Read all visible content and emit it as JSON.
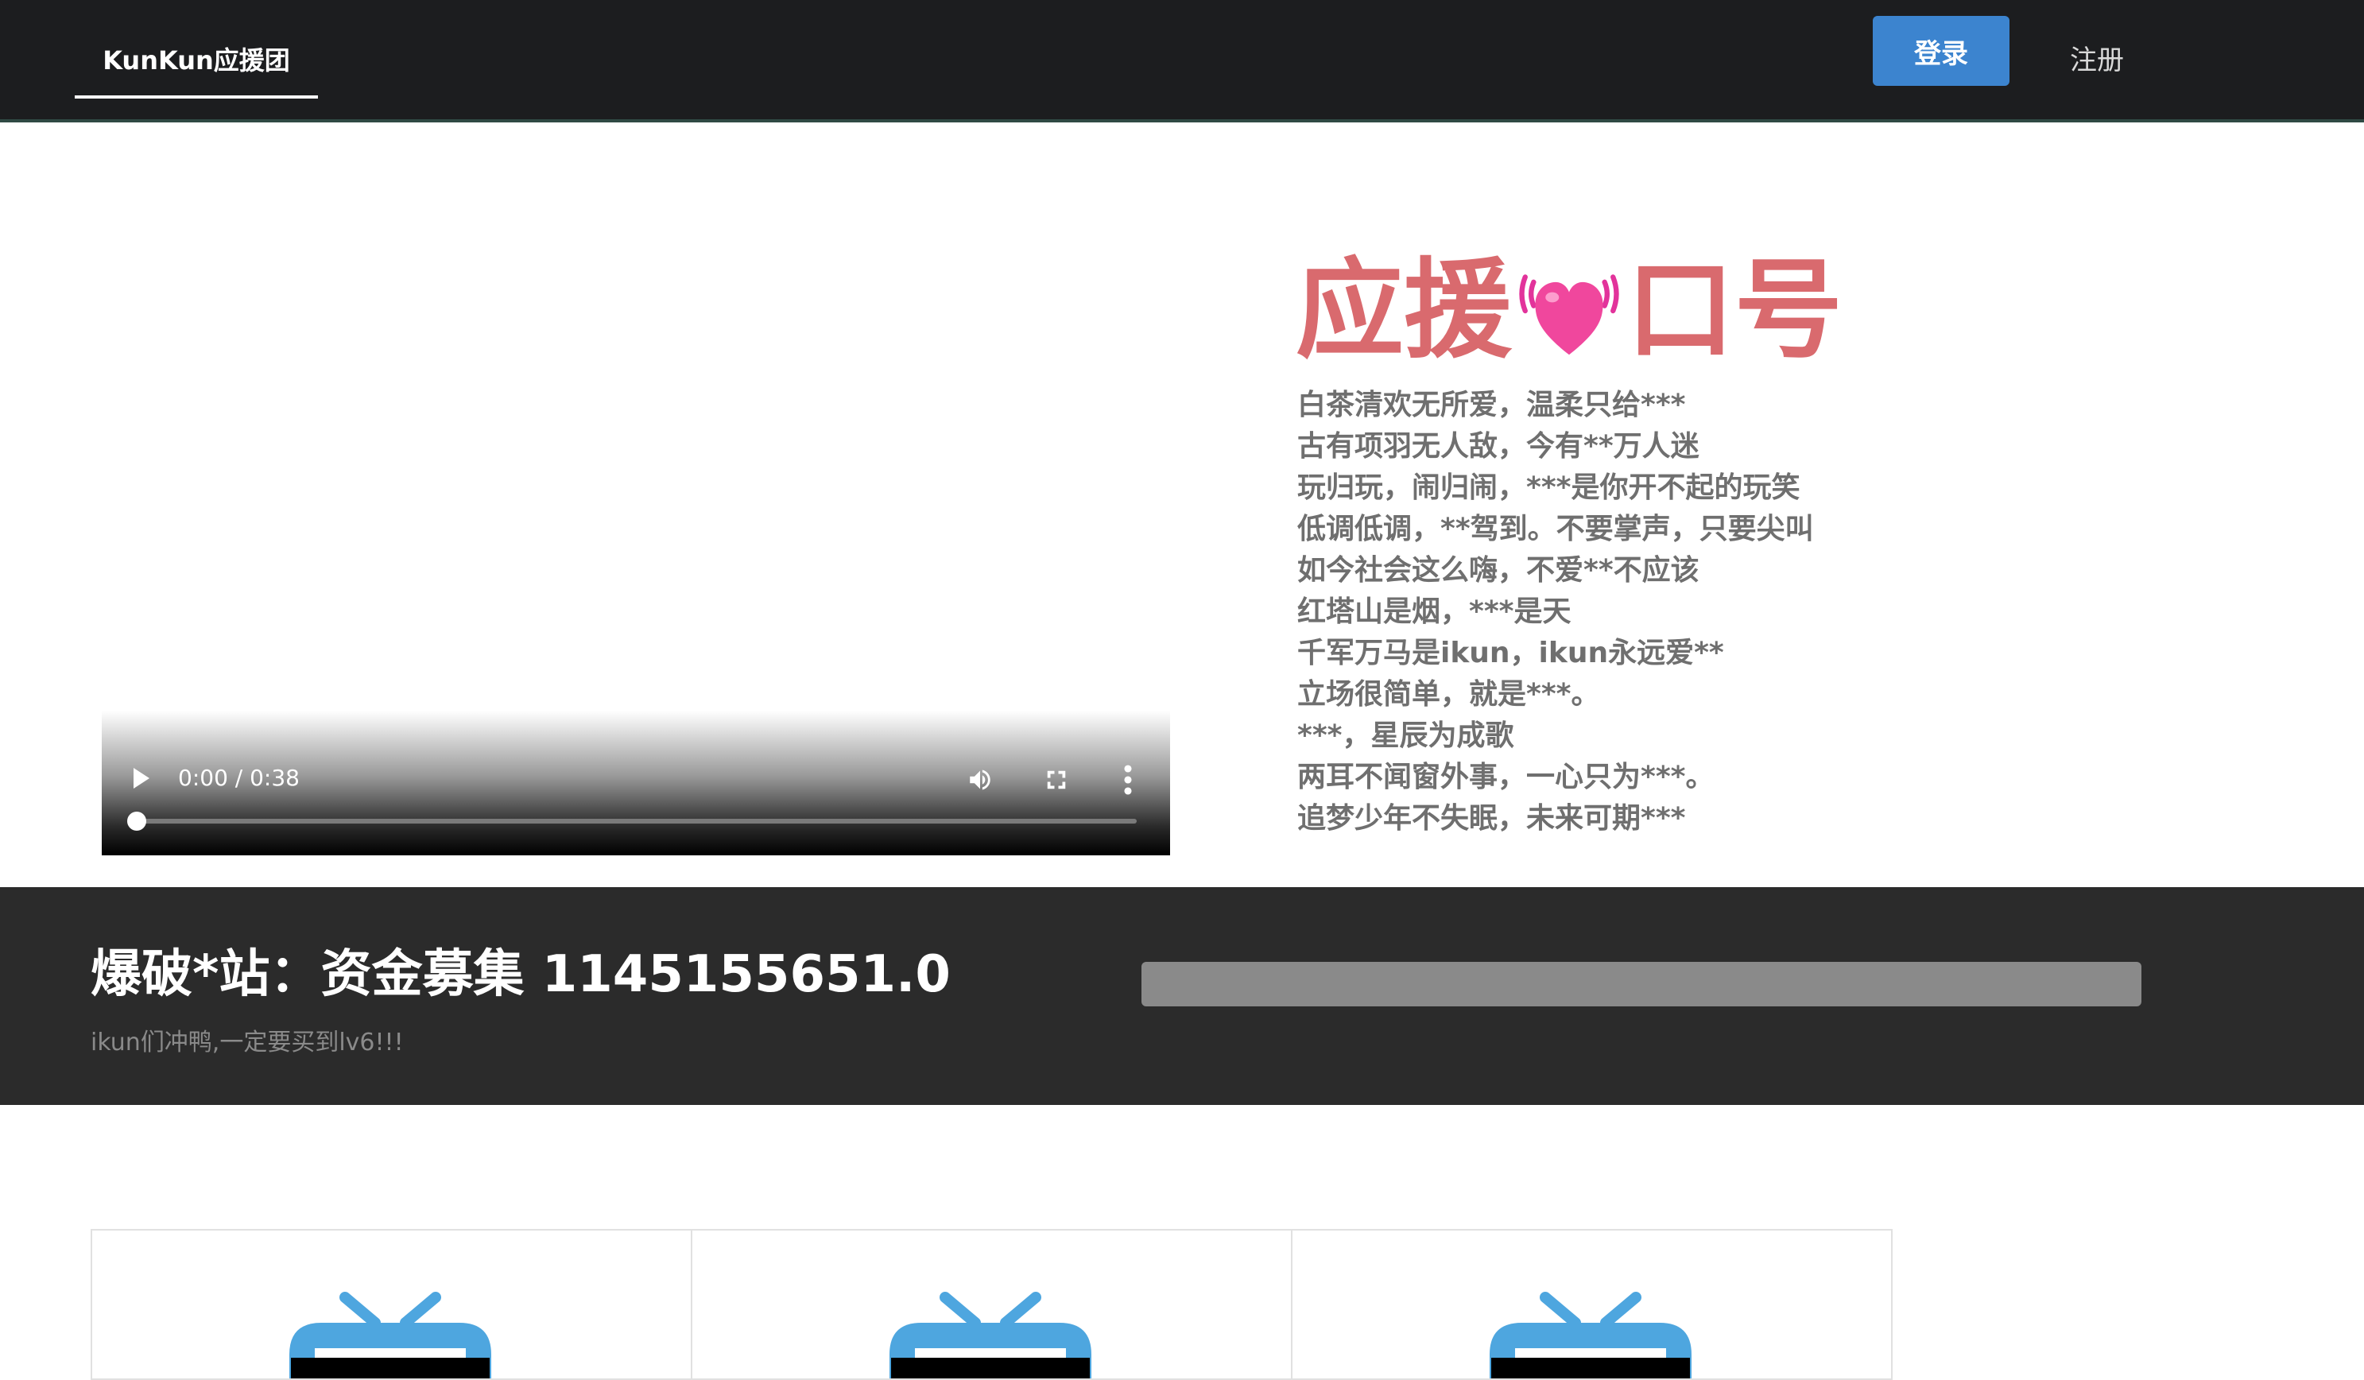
{
  "nav": {
    "brand": "KunKun应援团",
    "login_label": "登录",
    "register_label": "注册"
  },
  "video": {
    "time": "0:00 / 0:38"
  },
  "slogan": {
    "title_left": "应援",
    "title_right": "口号",
    "lines": [
      "白茶清欢无所爱，温柔只给***",
      "古有项羽无人敌，今有**万人迷",
      "玩归玩，闹归闹，***是你开不起的玩笑",
      "低调低调，**驾到。不要掌声，只要尖叫",
      "如今社会这么嗨，不爱**不应该",
      "红塔山是烟，***是天",
      "千军万马是ikun，ikun永远爱**",
      "立场很简单，就是***。",
      "***，星辰为成歌",
      "两耳不闻窗外事，一心只为***。",
      "追梦少年不失眠，未来可期***"
    ]
  },
  "funding": {
    "label": "爆破*站：资金募集 1145155651.0",
    "subtitle": "ikun们冲鸭,一定要买到lv6!!!",
    "progress_fraction": 0.0,
    "bar_color": "#8a8a8a"
  },
  "cards": [
    {
      "icon": "tv-icon"
    },
    {
      "icon": "tv-icon"
    },
    {
      "icon": "tv-icon"
    }
  ],
  "colors": {
    "nav_bg": "#1c1d1f",
    "login_btn": "#3c84cf",
    "slogan_title": "#d96a6e",
    "funding_bg": "#2b2b2b",
    "tv_icon": "#4ea6df"
  }
}
